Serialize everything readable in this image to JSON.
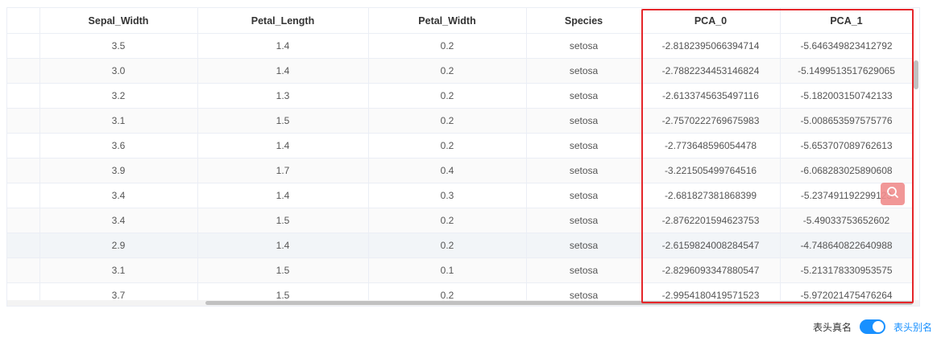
{
  "table": {
    "columns": [
      "",
      "Sepal_Width",
      "Petal_Length",
      "Petal_Width",
      "Species",
      "PCA_0",
      "PCA_1"
    ],
    "rows": [
      [
        "",
        "3.5",
        "1.4",
        "0.2",
        "setosa",
        "-2.8182395066394714",
        "-5.646349823412792"
      ],
      [
        "",
        "3.0",
        "1.4",
        "0.2",
        "setosa",
        "-2.7882234453146824",
        "-5.1499513517629065"
      ],
      [
        "",
        "3.2",
        "1.3",
        "0.2",
        "setosa",
        "-2.6133745635497116",
        "-5.182003150742133"
      ],
      [
        "",
        "3.1",
        "1.5",
        "0.2",
        "setosa",
        "-2.7570222769675983",
        "-5.008653597575776"
      ],
      [
        "",
        "3.6",
        "1.4",
        "0.2",
        "setosa",
        "-2.773648596054478",
        "-5.653707089762613"
      ],
      [
        "",
        "3.9",
        "1.7",
        "0.4",
        "setosa",
        "-3.221505499764516",
        "-6.068283025890608"
      ],
      [
        "",
        "3.4",
        "1.4",
        "0.3",
        "setosa",
        "-2.681827381868399",
        "-5.237491192299123"
      ],
      [
        "",
        "3.4",
        "1.5",
        "0.2",
        "setosa",
        "-2.8762201594623753",
        "-5.49033753652602"
      ],
      [
        "",
        "2.9",
        "1.4",
        "0.2",
        "setosa",
        "-2.6159824008284547",
        "-4.748640822640988"
      ],
      [
        "",
        "3.1",
        "1.5",
        "0.1",
        "setosa",
        "-2.8296093347880547",
        "-5.213178330953575"
      ],
      [
        "",
        "3.7",
        "1.5",
        "0.2",
        "setosa",
        "-2.9954180419571523",
        "-5.972021475476264"
      ]
    ]
  },
  "toggle": {
    "left_label": "表头真名",
    "right_label": "表头别名",
    "state": "on",
    "color": "#1890ff"
  },
  "highlight_color": "#e5262a",
  "float_button_icon": "search-icon"
}
